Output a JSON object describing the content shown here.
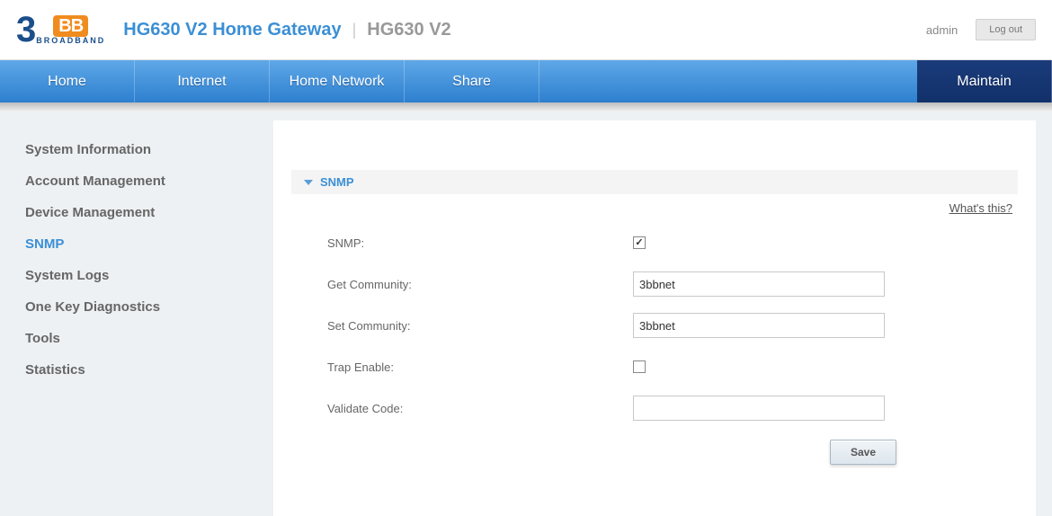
{
  "header": {
    "title1": "HG630 V2 Home Gateway",
    "title2": "HG630 V2",
    "user": "admin",
    "logout": "Log out"
  },
  "nav": {
    "items": [
      "Home",
      "Internet",
      "Home Network",
      "Share"
    ],
    "active": "Maintain"
  },
  "sidebar": {
    "items": [
      {
        "label": "System Information",
        "active": false
      },
      {
        "label": "Account Management",
        "active": false
      },
      {
        "label": "Device Management",
        "active": false
      },
      {
        "label": "SNMP",
        "active": true
      },
      {
        "label": "System Logs",
        "active": false
      },
      {
        "label": "One Key Diagnostics",
        "active": false
      },
      {
        "label": "Tools",
        "active": false
      },
      {
        "label": "Statistics",
        "active": false
      }
    ]
  },
  "panel": {
    "title": "SNMP",
    "whats_this": "What's this?"
  },
  "form": {
    "snmp_label": "SNMP:",
    "snmp_checked": true,
    "get_community_label": "Get Community:",
    "get_community_value": "3bbnet",
    "set_community_label": "Set Community:",
    "set_community_value": "3bbnet",
    "trap_enable_label": "Trap Enable:",
    "trap_enable_checked": false,
    "validate_code_label": "Validate Code:",
    "validate_code_value": "",
    "save_label": "Save"
  }
}
